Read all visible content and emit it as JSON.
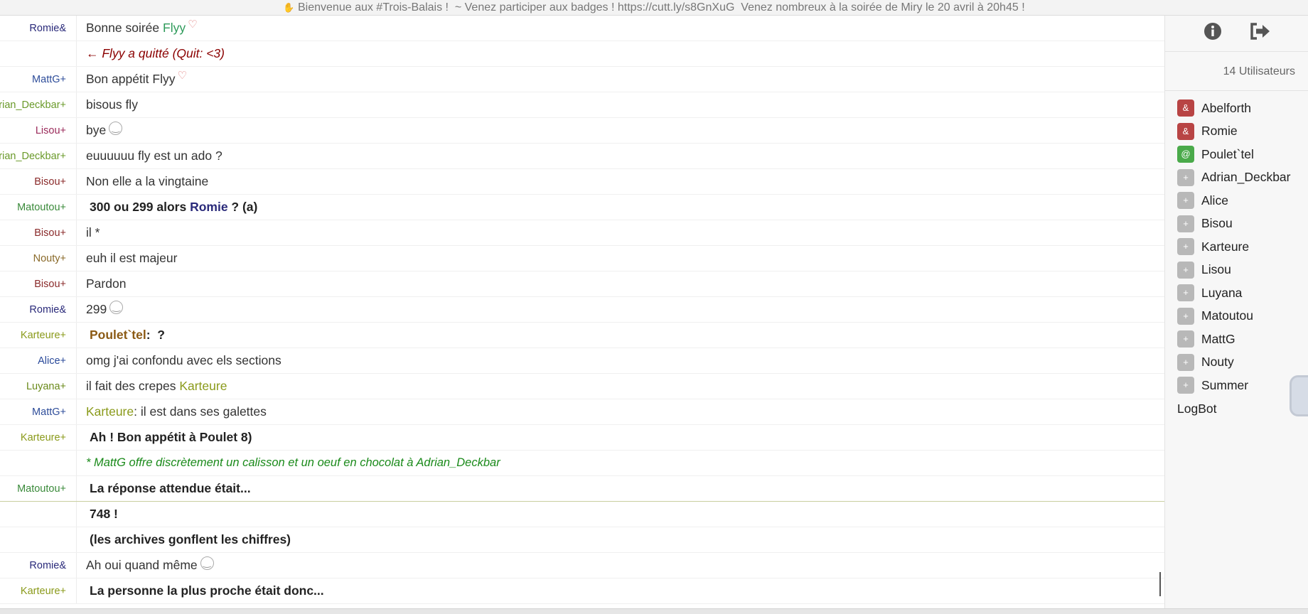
{
  "topic": {
    "text": "Bienvenue aux #Trois-Balais !  ~ Venez participer aux badges ! https://cutt.ly/s8GnXuG  Venez nombreux à la soirée de Miry le 20 avril à 20h45 !"
  },
  "colors": {
    "romie": "#2a2a7a",
    "flyy": "#2e9a5a",
    "mattg": "#2e4d9a",
    "adrian": "#6a9a2a",
    "lisou": "#9a2a5a",
    "bisou": "#8a2a2a",
    "matoutou": "#3a8a3a",
    "nouty": "#8a6a2a",
    "karteure": "#8a9a1a",
    "alice": "#2a4a9a",
    "luyana": "#6a8a1a",
    "poulet": "#8b5a14"
  },
  "messages": [
    {
      "nick": "&Romie",
      "color": "#2a2a7a",
      "text": "Bonne soirée ",
      "hl": "Flyy",
      "hlcolor": "#2e9a5a",
      "heart": true
    },
    {
      "nick": "",
      "color": "#888",
      "type": "quit",
      "text": "← Flyy a quitté (Quit: <3)"
    },
    {
      "nick": "+MattG",
      "color": "#2e4d9a",
      "text": "Bon appétit Flyy",
      "heart": true
    },
    {
      "nick": "+Adrian_Deckbar",
      "color": "#6a9a2a",
      "text": "bisous fly"
    },
    {
      "nick": "+Lisou",
      "color": "#9a2a5a",
      "text": "bye",
      "emoji": true
    },
    {
      "nick": "+Adrian_Deckbar",
      "color": "#6a9a2a",
      "text": "euuuuuu fly est un ado ?"
    },
    {
      "nick": "+Bisou",
      "color": "#8a2a2a",
      "text": "Non elle a la vingtaine"
    },
    {
      "nick": "+Matoutou",
      "color": "#3a8a3a",
      "type": "bold",
      "text": "300 ou 299 alors ",
      "hl": "Romie",
      "hlcolor": "#2a2a7a",
      "after": " ? (a)"
    },
    {
      "nick": "+Bisou",
      "color": "#8a2a2a",
      "text": "il *"
    },
    {
      "nick": "+Nouty",
      "color": "#8a6a2a",
      "text": "euh il est majeur"
    },
    {
      "nick": "+Bisou",
      "color": "#8a2a2a",
      "text": "Pardon"
    },
    {
      "nick": "&Romie",
      "color": "#2a2a7a",
      "text": "299",
      "emoji": true
    },
    {
      "nick": "+Karteure",
      "color": "#8a9a1a",
      "type": "bold",
      "hl": "Poulet`tel",
      "hlcolor": "#8b5a14",
      "after": ":  ?"
    },
    {
      "nick": "+Alice",
      "color": "#2a4a9a",
      "text": "omg j'ai confondu avec els sections"
    },
    {
      "nick": "+Luyana",
      "color": "#6a8a1a",
      "text": "il fait des crepes ",
      "hl": "Karteure",
      "hlcolor": "#8a9a1a"
    },
    {
      "nick": "+MattG",
      "color": "#2e4d9a",
      "hl": "Karteure",
      "hlcolor": "#8a9a1a",
      "after": ": il est dans ses galettes"
    },
    {
      "nick": "+Karteure",
      "color": "#8a9a1a",
      "type": "bold",
      "text": "Ah ! Bon appétit à Poulet 8)"
    },
    {
      "nick": "",
      "color": "#888",
      "type": "action",
      "text": "* MattG offre discrètement un calisson et un oeuf en chocolat à Adrian_Deckbar"
    },
    {
      "nick": "+Matoutou",
      "color": "#3a8a3a",
      "type": "bold",
      "text": "La réponse attendue était...",
      "marker": true
    },
    {
      "nick": "",
      "color": "#888",
      "type": "bold",
      "text": "748 !"
    },
    {
      "nick": "",
      "color": "#888",
      "type": "bold",
      "text": "(les archives gonflent les chiffres)"
    },
    {
      "nick": "&Romie",
      "color": "#2a2a7a",
      "text": "Ah oui quand même",
      "emoji": true
    },
    {
      "nick": "+Karteure",
      "color": "#8a9a1a",
      "type": "bold",
      "text": "La personne la plus proche était donc..."
    }
  ],
  "sidebar": {
    "user_count": "14 Utilisateurs",
    "users": [
      {
        "prefix": "&",
        "name": "Abelforth",
        "badge": "#b84444"
      },
      {
        "prefix": "&",
        "name": "Romie",
        "badge": "#b84444"
      },
      {
        "prefix": "@",
        "name": "Poulet`tel",
        "badge": "#4aaa4a"
      },
      {
        "prefix": "+",
        "name": "Adrian_Deckbar",
        "badge": "#b8b8b8"
      },
      {
        "prefix": "+",
        "name": "Alice",
        "badge": "#b8b8b8"
      },
      {
        "prefix": "+",
        "name": "Bisou",
        "badge": "#b8b8b8"
      },
      {
        "prefix": "+",
        "name": "Karteure",
        "badge": "#b8b8b8"
      },
      {
        "prefix": "+",
        "name": "Lisou",
        "badge": "#b8b8b8"
      },
      {
        "prefix": "+",
        "name": "Luyana",
        "badge": "#b8b8b8"
      },
      {
        "prefix": "+",
        "name": "Matoutou",
        "badge": "#b8b8b8"
      },
      {
        "prefix": "+",
        "name": "MattG",
        "badge": "#b8b8b8"
      },
      {
        "prefix": "+",
        "name": "Nouty",
        "badge": "#b8b8b8"
      },
      {
        "prefix": "+",
        "name": "Summer",
        "badge": "#b8b8b8"
      }
    ],
    "bot": "LogBot",
    "info_icon": "info-icon",
    "logout_icon": "logout-icon"
  }
}
